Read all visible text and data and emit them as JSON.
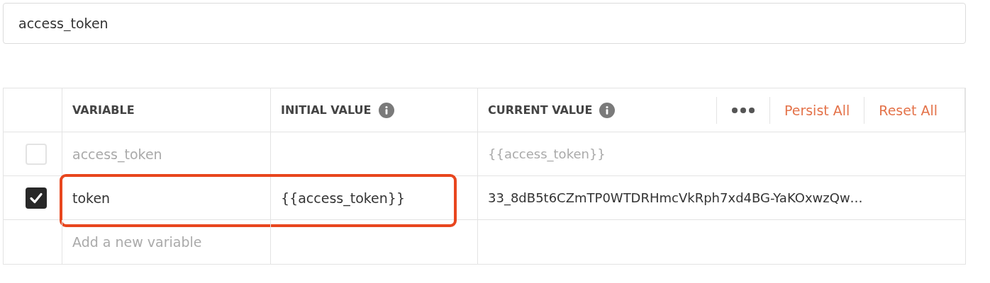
{
  "name_field": {
    "value": "access_token"
  },
  "table": {
    "columns": [
      {
        "label": "VARIABLE",
        "info": false
      },
      {
        "label": "INITIAL VALUE",
        "info": true
      },
      {
        "label": "CURRENT VALUE",
        "info": true
      }
    ],
    "actions": [
      "Persist All",
      "Reset All"
    ],
    "rows": [
      {
        "checked": false,
        "disabled": true,
        "highlighted": false,
        "variable": "access_token",
        "current_value": "{{access_token}}"
      },
      {
        "checked": true,
        "disabled": false,
        "highlighted": true,
        "variable": "token",
        "initial_value": "{{access_token}}",
        "current_value": "33_8dB5t6CZmTP0WTDRHmcVkRph7xd4BG-YaKOxwzQw…"
      }
    ],
    "new_row": {
      "placeholder": "Add a new variable"
    }
  }
}
